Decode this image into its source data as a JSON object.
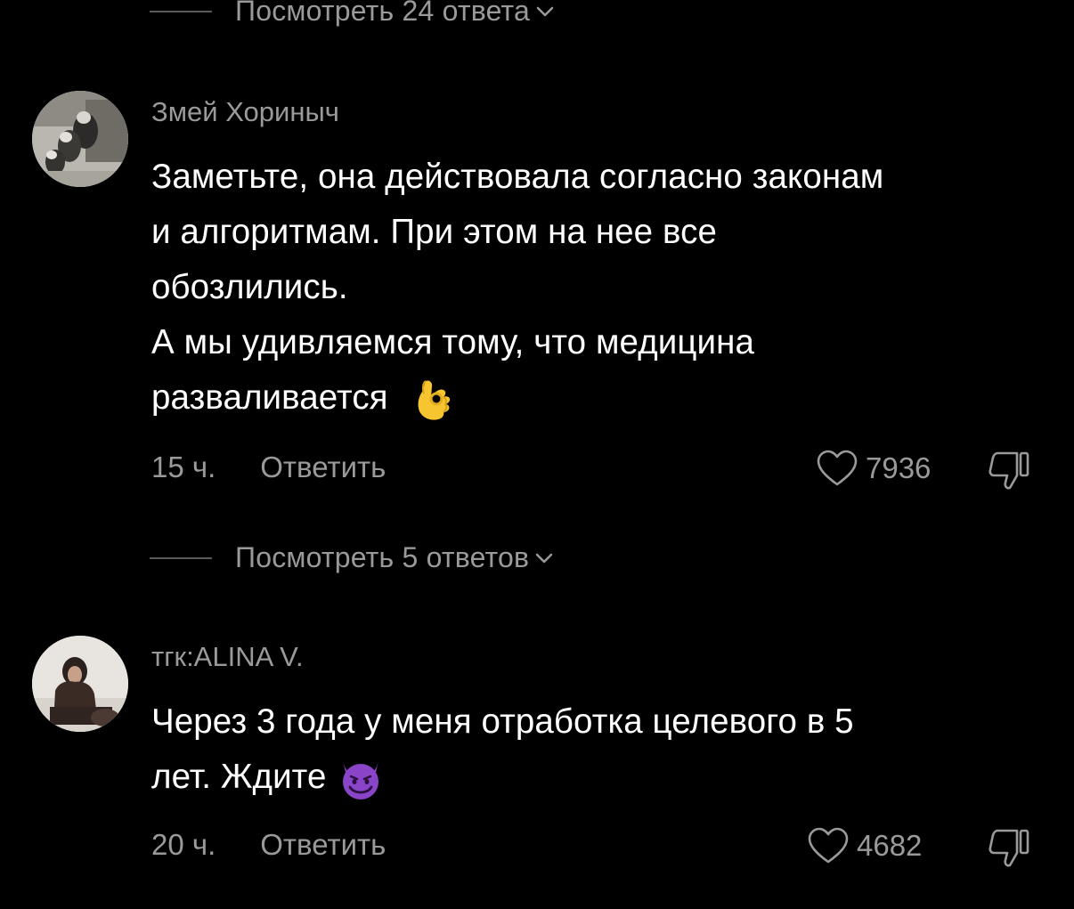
{
  "top_view_replies": {
    "label": "Посмотреть 24 ответа"
  },
  "comments": [
    {
      "author": "Змей Хориныч",
      "lines": [
        "Заметьте, она действовала согласно законам",
        "и алгоритмам. При этом на нее все",
        "обозлились.",
        "А мы удивляемся тому, что медицина",
        "разваливается"
      ],
      "emoji": "ok-hand-emoji",
      "time": "15 ч.",
      "reply_label": "Ответить",
      "likes": "7936",
      "view_replies": "Посмотреть 5 ответов"
    },
    {
      "author": "тгк:ALINA V.",
      "lines": [
        "Через 3 года у меня отработка целевого в 5",
        "лет. Ждите"
      ],
      "emoji": "smiling-devil-emoji",
      "time": "20 ч.",
      "reply_label": "Ответить",
      "likes": "4682"
    }
  ],
  "colors": {
    "background": "#000000",
    "text_primary": "#ffffff",
    "text_secondary": "#9a9a9a",
    "divider": "#5a5a5a"
  }
}
